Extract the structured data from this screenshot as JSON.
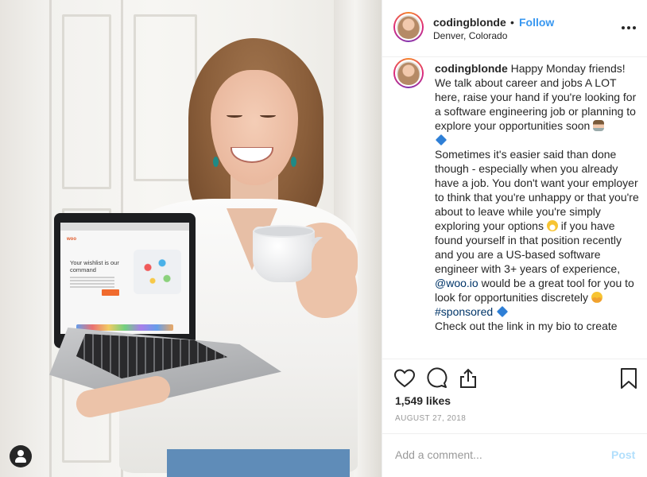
{
  "post": {
    "username": "codingblonde",
    "separator": "•",
    "follow_label": "Follow",
    "location": "Denver, Colorado",
    "caption": {
      "p1": "Happy Monday friends! We talk about career and jobs A LOT here, raise your hand if you're looking for a software engineering job or planning to explore your opportunities soon",
      "p2": "Sometimes it's easier said than done though - especially when you already have a job. You don't want your employer to think that you're unhappy or that you're about to leave while you're simply exploring your options",
      "p3a": "if you have found yourself in that position recently and you are a US-based software engineer with 3+ years of experience,",
      "mention": "@woo.io",
      "p3b": "would be a great tool for you to look for opportunities discretely",
      "hashtag": "#sponsored",
      "p4": "Check out the link in my bio to create"
    },
    "likes": "1,549 likes",
    "date": "AUGUST 27, 2018",
    "comment_placeholder": "Add a comment...",
    "post_label": "Post"
  },
  "laptop_site": {
    "logo": "woo",
    "headline": "Your wishlist is our command"
  },
  "icons": [
    "more-icon",
    "heart-icon",
    "comment-icon",
    "share-icon",
    "bookmark-icon",
    "profile-icon"
  ],
  "colors": {
    "link": "#3897f0",
    "mention": "#003569",
    "post_disabled": "#b2dffc",
    "muted": "#999999"
  }
}
